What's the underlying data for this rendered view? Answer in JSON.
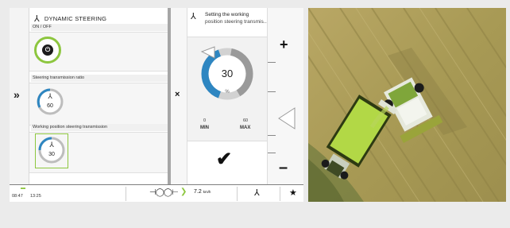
{
  "left_panel": {
    "title": "DYNAMIC STEERING",
    "onoff_label": "ON / OFF",
    "ratio_label": "Steering transmission ratio",
    "ratio_value": "60",
    "position_label": "Working position steering transmission",
    "position_value": "30",
    "expand_glyph": "»"
  },
  "middle": {
    "close_glyph": "×"
  },
  "right_panel": {
    "title_line1": "Setting the working",
    "title_line2": "position steering transmis...",
    "gauge_value": "30",
    "gauge_unit": "%",
    "min_value": "0",
    "max_value": "60",
    "min_label": "MIN",
    "max_label": "MAX",
    "gauge_fraction": 0.5,
    "confirm_glyph": "✔"
  },
  "right_strip": {
    "plus_glyph": "+",
    "minus_glyph": "–"
  },
  "footer": {
    "battery_glyph": "▬",
    "time1": "08:47",
    "time2": "13:25",
    "tractor_glyph": "⊣◯◯⊢",
    "speed": "7.2",
    "speed_unit": "km/h",
    "star_glyph": "★"
  },
  "colors": {
    "accent_green": "#8dc63f",
    "gauge_blue": "#2e86c1",
    "gauge_grey": "#9a9a9a",
    "divider": "#a6a6a6"
  },
  "icons": [
    "steering-icon",
    "power-icon",
    "steering-dial-icon",
    "double-chevron-right-icon",
    "close-icon",
    "plus-icon",
    "minus-icon",
    "triangle-left-icon",
    "checkmark-icon",
    "battery-icon",
    "tractor-icon",
    "steering-wheel-icon",
    "star-icon"
  ]
}
